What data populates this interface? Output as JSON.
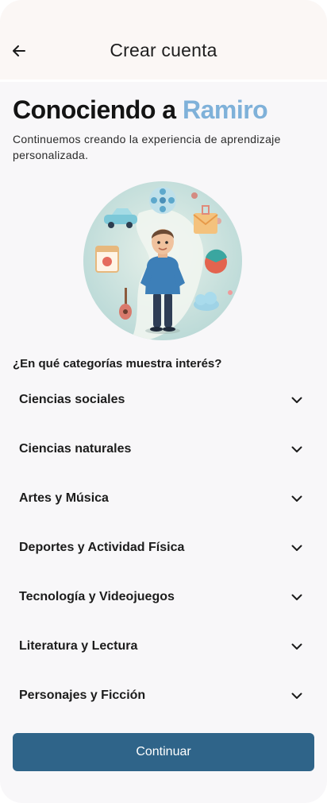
{
  "header": {
    "title": "Crear cuenta",
    "back_icon": "arrow-left-icon"
  },
  "hero": {
    "title_prefix": "Conociendo a",
    "title_name": "Ramiro",
    "accent_color": "#7fb1d9",
    "subtitle": "Continuemos creando la experiencia de aprendizaje personalizada."
  },
  "illustration": {
    "icons": [
      "car-icon",
      "film-reel-icon",
      "gift-envelope-icon",
      "calendar-icon",
      "ball-icon",
      "guitar-icon",
      "cloud-icon",
      "person-figure"
    ]
  },
  "question": "¿En qué categorías muestra interés?",
  "categories": [
    {
      "label": "Ciencias sociales"
    },
    {
      "label": "Ciencias naturales"
    },
    {
      "label": "Artes y Música"
    },
    {
      "label": "Deportes y Actividad Física"
    },
    {
      "label": "Tecnología y Videojuegos"
    },
    {
      "label": "Literatura y Lectura"
    },
    {
      "label": "Personajes y Ficción"
    }
  ],
  "continue_button": {
    "label": "Continuar",
    "color": "#2f6489"
  }
}
